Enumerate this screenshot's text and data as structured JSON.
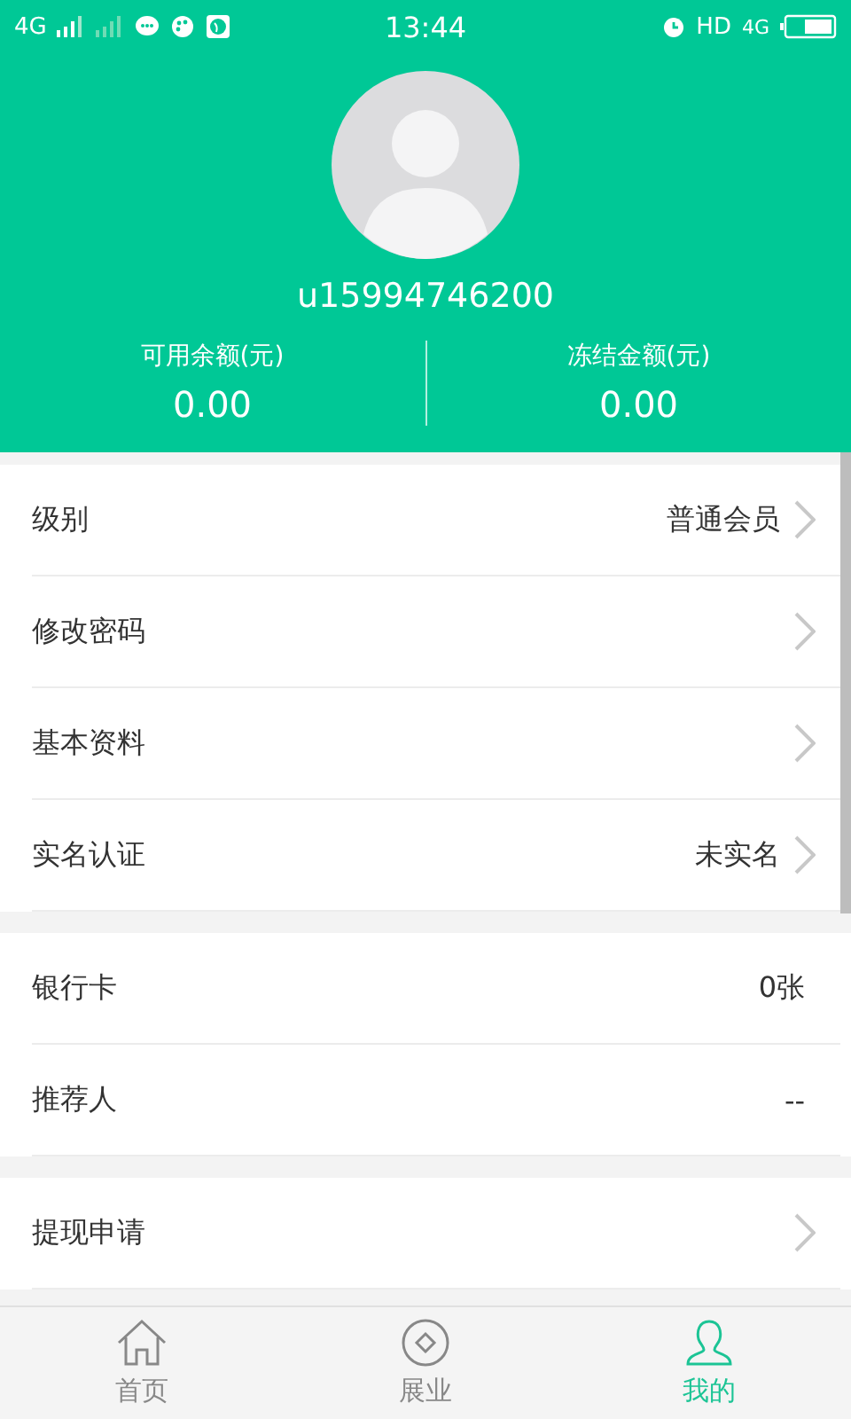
{
  "status_bar": {
    "network_left": "4G",
    "time": "13:44",
    "hd": "HD",
    "network_right": "4G"
  },
  "profile": {
    "username": "u15994746200"
  },
  "balances": [
    {
      "label": "可用余额(元)",
      "amount": "0.00"
    },
    {
      "label": "冻结金额(元)",
      "amount": "0.00"
    }
  ],
  "menu_groups": [
    {
      "items": [
        {
          "label": "级别",
          "value": "普通会员",
          "arrow": true
        },
        {
          "label": "修改密码",
          "arrow": true
        },
        {
          "label": "基本资料",
          "arrow": true
        },
        {
          "label": "实名认证",
          "value": "未实名",
          "arrow": true
        }
      ]
    },
    {
      "items": [
        {
          "label": "银行卡",
          "value": "0张",
          "arrow": false
        },
        {
          "label": "推荐人",
          "value": "--",
          "arrow": false
        }
      ]
    },
    {
      "items": [
        {
          "label": "提现申请",
          "arrow": true
        }
      ]
    }
  ],
  "tab_bar": [
    {
      "kind": "home",
      "label": "首页",
      "selected": false
    },
    {
      "kind": "business",
      "label": "展业",
      "selected": false
    },
    {
      "kind": "me",
      "label": "我的",
      "selected": true
    }
  ]
}
